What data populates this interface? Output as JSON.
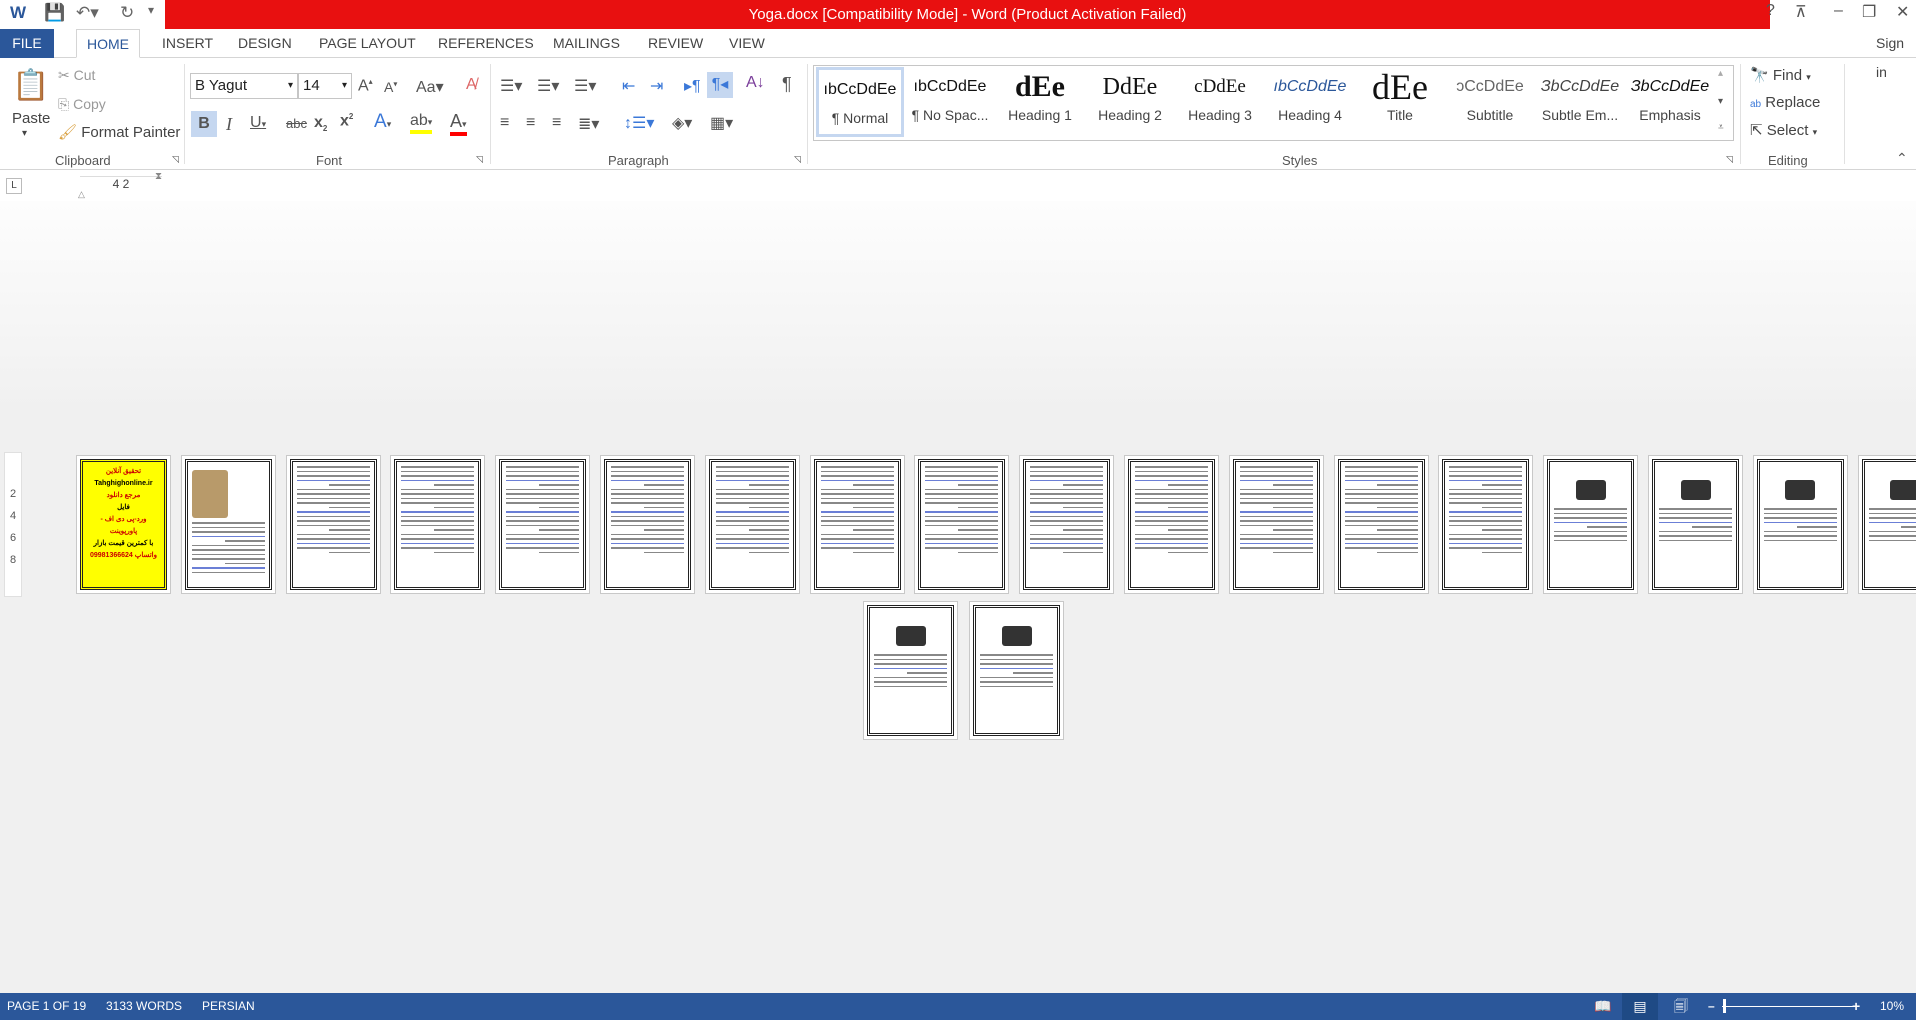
{
  "window": {
    "title": "Yoga.docx [Compatibility Mode] -  Word (Product Activation Failed)",
    "sign_in": "Sign in",
    "help": "?",
    "controls": [
      "ribbon-display",
      "minimize",
      "restore",
      "close"
    ]
  },
  "colors": {
    "title_bar": "#e81010",
    "accent": "#2b579a"
  },
  "tabs": [
    "FILE",
    "HOME",
    "INSERT",
    "DESIGN",
    "PAGE LAYOUT",
    "REFERENCES",
    "MAILINGS",
    "REVIEW",
    "VIEW"
  ],
  "clipboard": {
    "paste": "Paste",
    "cut": "Cut",
    "copy": "Copy",
    "format_painter": "Format Painter",
    "group": "Clipboard"
  },
  "font": {
    "name": "B Yagut",
    "size": "14",
    "group": "Font",
    "case": "Aa"
  },
  "paragraph": {
    "group": "Paragraph"
  },
  "styles": {
    "group": "Styles",
    "items": [
      {
        "sample": "ıbCcDdEe",
        "name": "¶ Normal"
      },
      {
        "sample": "ıbCcDdEe",
        "name": "¶ No Spac..."
      },
      {
        "sample": "dEe",
        "name": "Heading 1"
      },
      {
        "sample": "DdEe",
        "name": "Heading 2"
      },
      {
        "sample": "cDdEe",
        "name": "Heading 3"
      },
      {
        "sample": "ıbCcDdEe",
        "name": "Heading 4"
      },
      {
        "sample": "dEe",
        "name": "Title"
      },
      {
        "sample": "ɔCcDdEe",
        "name": "Subtitle"
      },
      {
        "sample": "ЗbCcDdEe",
        "name": "Subtle Em..."
      },
      {
        "sample": "ЗbCcDdEe",
        "name": "Emphasis"
      }
    ]
  },
  "editing": {
    "find": "Find",
    "replace": "Replace",
    "select": "Select",
    "group": "Editing"
  },
  "ruler": {
    "marks": "4  2",
    "vmarks": [
      "2",
      "4",
      "6",
      "8"
    ]
  },
  "pages": {
    "count": 20,
    "cover_text": [
      "تحقیق آنلاین",
      "Tahghighonline.ir",
      "مرجع دانلود",
      "فایل",
      "ورد-پی دی اف - پاورپوینت",
      "با کمترین قیمت بازار",
      "09981366624 واتساپ"
    ]
  },
  "status": {
    "page": "PAGE 1 OF 19",
    "words": "3133 WORDS",
    "language": "PERSIAN",
    "zoom": "10%",
    "zoom_level_percent": 10
  }
}
